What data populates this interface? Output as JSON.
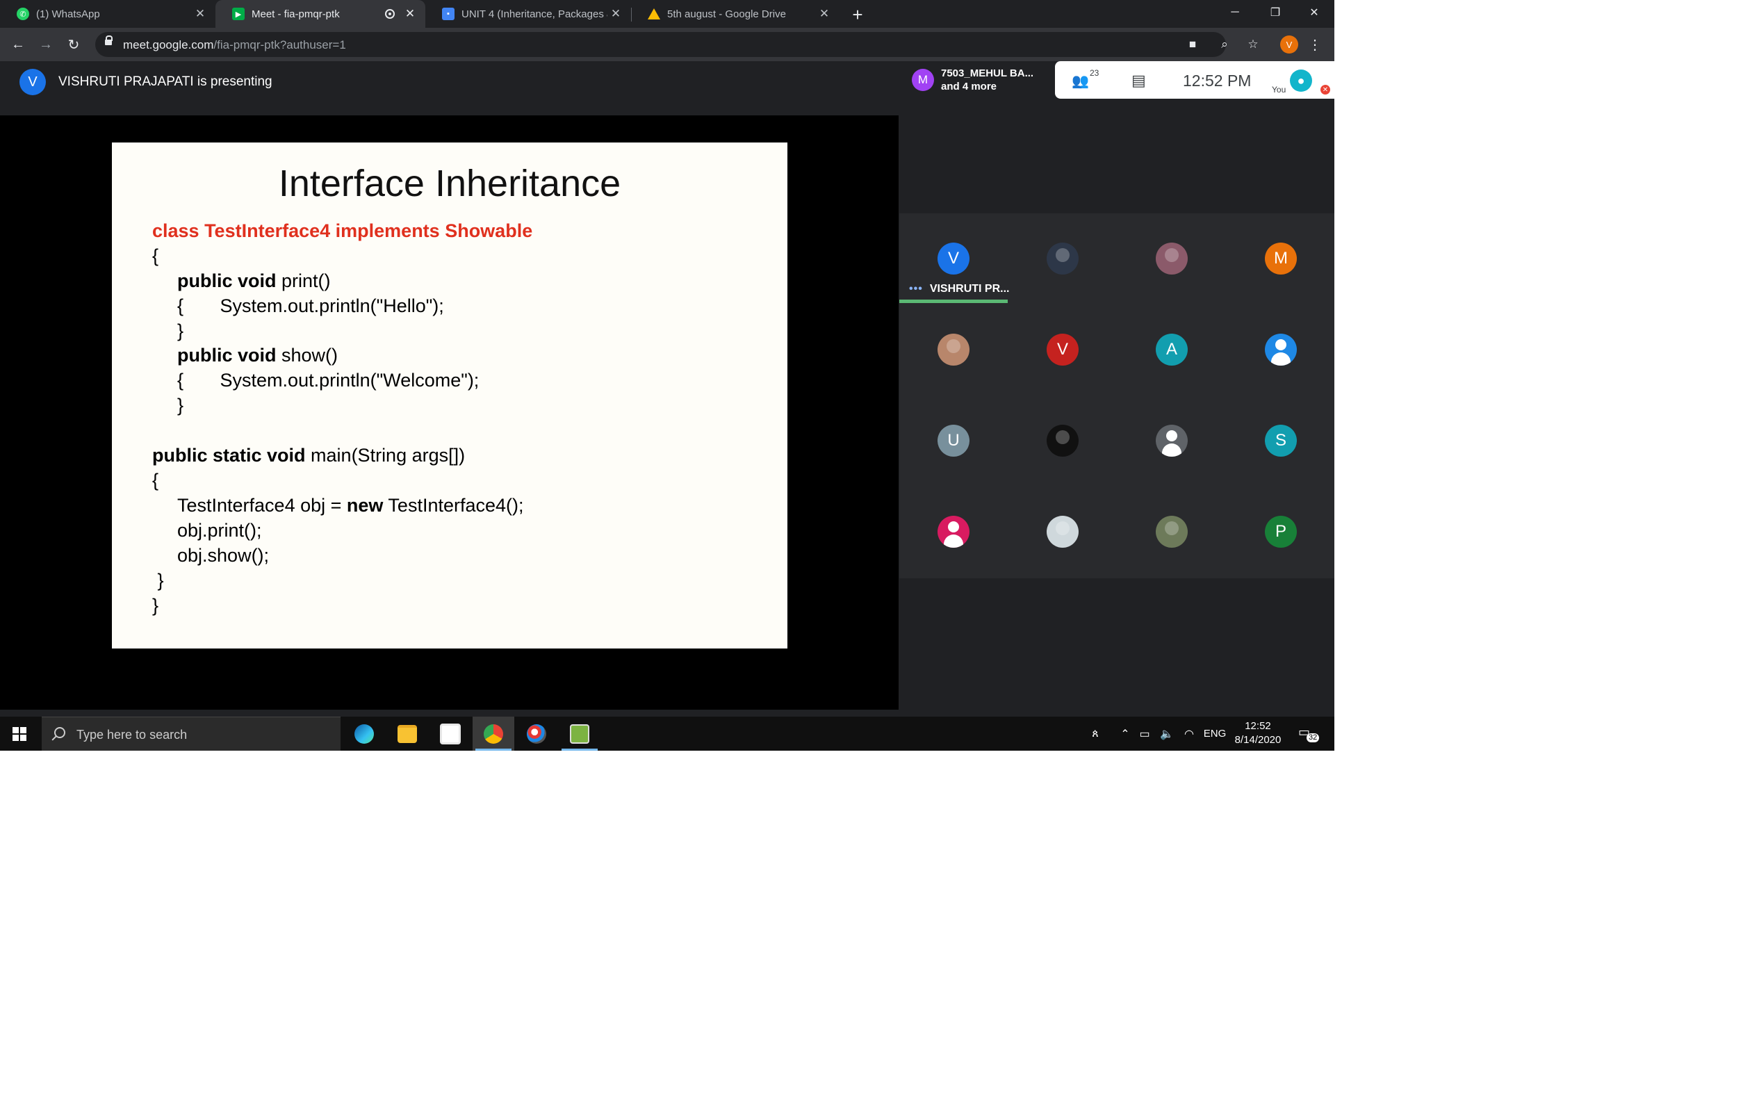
{
  "browser": {
    "tabs": [
      {
        "title": "(1) WhatsApp",
        "icon": "whatsapp-icon",
        "color": "#25d366",
        "active": false
      },
      {
        "title": "Meet - fia-pmqr-ptk",
        "icon": "meet-icon",
        "color": "#00ac47",
        "active": true
      },
      {
        "title": "UNIT 4 (Inheritance, Packages &",
        "icon": "classroom-icon",
        "color": "#4285f4",
        "active": false
      },
      {
        "title": "5th august - Google Drive",
        "icon": "drive-icon",
        "color": "#fbbc04",
        "active": false
      }
    ],
    "url_host": "meet.google.com",
    "url_path": "/fia-pmqr-ptk?authuser=1",
    "profile_letter": "V"
  },
  "meet": {
    "presenter_initial": "V",
    "presenting_text": "VISHRUTI PRAJAPATI is presenting",
    "chip": {
      "initial": "M",
      "line1": "7503_MEHUL BA...",
      "line2": "and 4 more"
    },
    "participant_count": "23",
    "time": "12:52  PM",
    "you_label": "You",
    "speaker_label": "VISHRUTI PR...",
    "participants": [
      {
        "initial": "V",
        "color": "#1a73e8",
        "kind": "letter"
      },
      {
        "initial": "",
        "color": "#2d3748",
        "kind": "photo"
      },
      {
        "initial": "",
        "color": "#8b5a6a",
        "kind": "photo"
      },
      {
        "initial": "M",
        "color": "#e8710a",
        "kind": "letter"
      },
      {
        "initial": "",
        "color": "#b8866b",
        "kind": "photo"
      },
      {
        "initial": "V",
        "color": "#c5221f",
        "kind": "letter"
      },
      {
        "initial": "A",
        "color": "#129eaf",
        "kind": "letter"
      },
      {
        "initial": "",
        "color": "#1e88e5",
        "kind": "person"
      },
      {
        "initial": "U",
        "color": "#78909c",
        "kind": "letter"
      },
      {
        "initial": "",
        "color": "#111111",
        "kind": "photo"
      },
      {
        "initial": "",
        "color": "#5f6368",
        "kind": "person"
      },
      {
        "initial": "S",
        "color": "#129eaf",
        "kind": "letter"
      },
      {
        "initial": "",
        "color": "#d81b60",
        "kind": "person"
      },
      {
        "initial": "",
        "color": "#cfd8dc",
        "kind": "photo"
      },
      {
        "initial": "",
        "color": "#6d7a5a",
        "kind": "photo"
      },
      {
        "initial": "P",
        "color": "#188038",
        "kind": "letter"
      }
    ]
  },
  "slide": {
    "title": "Interface Inheritance",
    "class_decl": "class TestInterface4 implements Showable",
    "lines": {
      "open1": "{",
      "print_kw": "public void",
      "print_rest": " print()",
      "print_body": "{       System.out.println(\"Hello\");",
      "close_a": "}",
      "show_kw": "public void",
      "show_rest": " show()",
      "show_body": "{       System.out.println(\"Welcome\");",
      "close_b": "}",
      "main_kw": "public static void",
      "main_rest": " main(String args[])",
      "open2": "{",
      "obj_a": "TestInterface4 obj = ",
      "obj_new": "new",
      "obj_b": " TestInterface4();",
      "call_print": "obj.print();",
      "call_show": "obj.show();",
      "close_c": " }",
      "close_d": "}"
    }
  },
  "taskbar": {
    "search_placeholder": "Type here to search",
    "apps": [
      "edge-icon",
      "file-explorer-icon",
      "store-icon",
      "chrome-icon",
      "paint-icon",
      "editor-icon"
    ],
    "lang": "ENG",
    "time": "12:52",
    "date": "8/14/2020",
    "notification_count": "32"
  }
}
